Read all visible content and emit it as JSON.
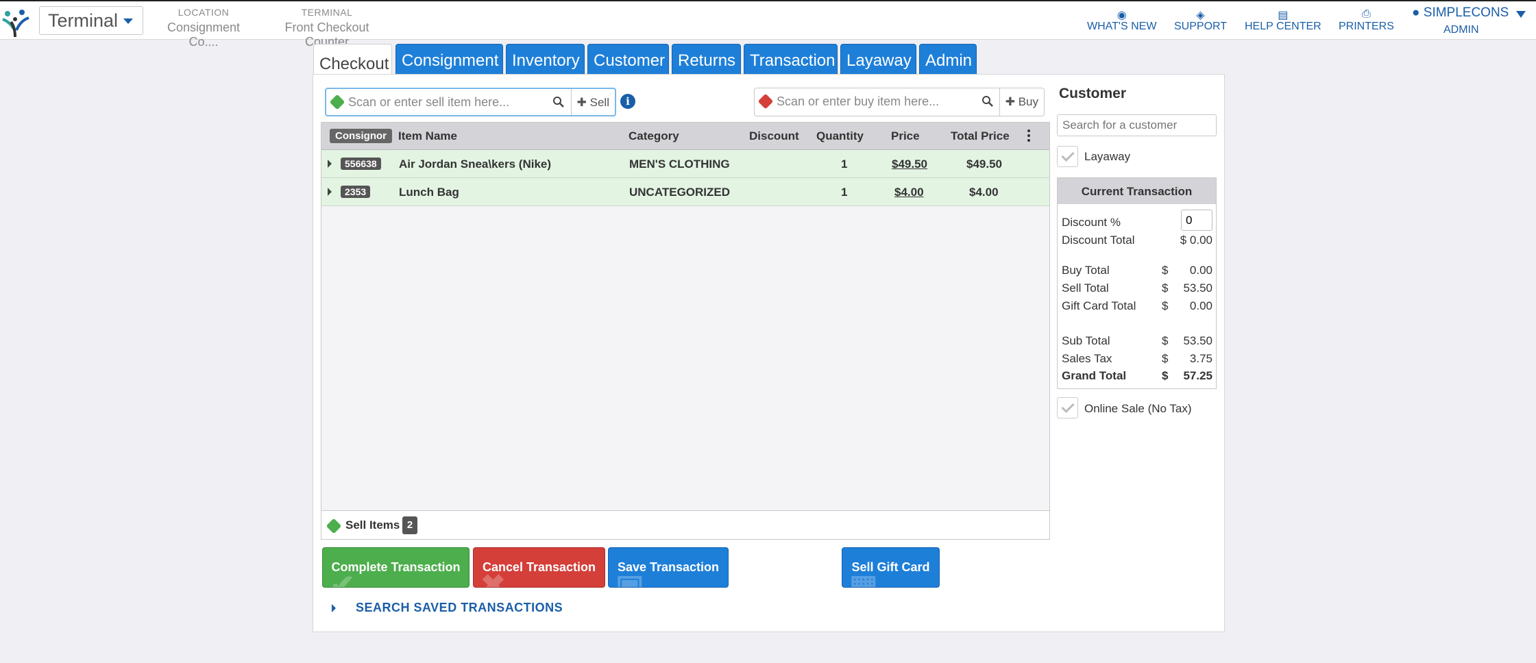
{
  "header": {
    "app_selector": "Terminal",
    "location_label": "LOCATION",
    "location_value": "Consignment Co....",
    "terminal_label": "TERMINAL",
    "terminal_value": "Front Checkout Counter",
    "nav": {
      "whats_new": "WHAT'S NEW",
      "support": "SUPPORT",
      "help_center": "HELP CENTER",
      "printers": "PRINTERS"
    },
    "user_name": "SIMPLECONS",
    "user_role": "ADMIN"
  },
  "tabs": [
    "Checkout",
    "Consignment",
    "Inventory",
    "Customer",
    "Returns",
    "Transaction",
    "Layaway",
    "Admin"
  ],
  "sell_scan": {
    "placeholder": "Scan or enter sell item here...",
    "button": "Sell"
  },
  "buy_scan": {
    "placeholder": "Scan or enter buy item here...",
    "button": "Buy"
  },
  "table": {
    "columns": {
      "consignor": "Consignor",
      "item_name": "Item Name",
      "category": "Category",
      "discount": "Discount",
      "quantity": "Quantity",
      "price": "Price",
      "total_price": "Total Price"
    },
    "rows": [
      {
        "consignor": "556638",
        "item_name": "Air Jordan Snea\\kers (Nike)",
        "category": "MEN'S CLOTHING",
        "discount": "",
        "quantity": "1",
        "price": "$49.50",
        "total": "$49.50"
      },
      {
        "consignor": "2353",
        "item_name": "Lunch Bag",
        "category": "UNCATEGORIZED",
        "discount": "",
        "quantity": "1",
        "price": "$4.00",
        "total": "$4.00"
      }
    ],
    "footer_label": "Sell Items",
    "footer_count": "2"
  },
  "actions": {
    "complete": "Complete Transaction",
    "cancel": "Cancel Transaction",
    "save": "Save Transaction",
    "gift_card": "Sell Gift Card",
    "search_saved": "SEARCH SAVED TRANSACTIONS"
  },
  "sidebar": {
    "title": "Customer",
    "search_placeholder": "Search for a customer",
    "layaway_label": "Layaway",
    "current_tx_title": "Current Transaction",
    "discount_pct_label": "Discount %",
    "discount_pct_value": "0",
    "discount_total_label": "Discount Total",
    "discount_total_value": "$ 0.00",
    "lines": [
      {
        "label": "Buy Total",
        "cur": "$",
        "value": "0.00"
      },
      {
        "label": "Sell Total",
        "cur": "$",
        "value": "53.50"
      },
      {
        "label": "Gift Card Total",
        "cur": "$",
        "value": "0.00"
      },
      {
        "label": "Sub Total",
        "cur": "$",
        "value": "53.50"
      },
      {
        "label": "Sales Tax",
        "cur": "$",
        "value": "3.75"
      },
      {
        "label": "Grand Total",
        "cur": "$",
        "value": "57.25"
      }
    ],
    "online_sale_label": "Online Sale (No Tax)"
  },
  "colors": {
    "primary_blue": "#1e7fd8",
    "success_green": "#4cae4c",
    "danger_red": "#d43f3a",
    "row_highlight": "#e3f4e3"
  }
}
